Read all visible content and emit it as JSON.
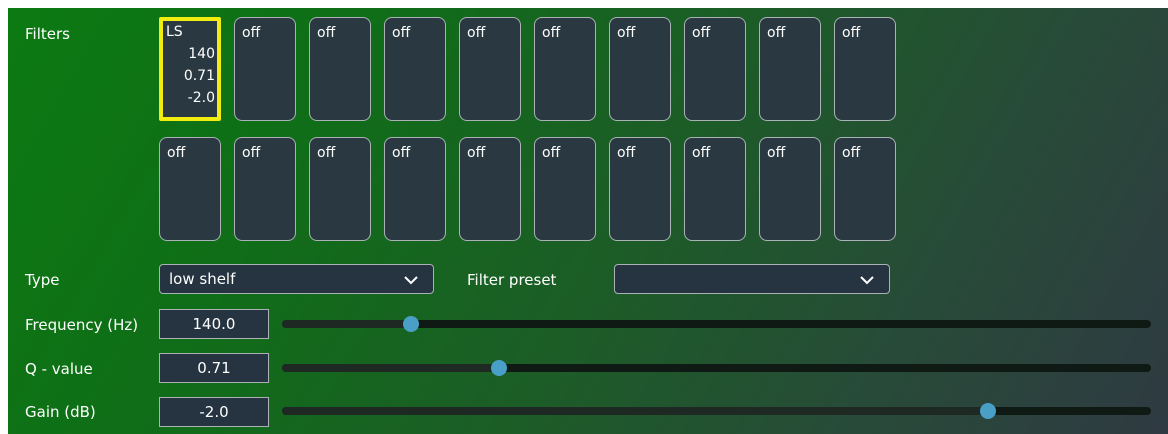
{
  "filters": {
    "label": "Filters",
    "row1": [
      {
        "lines": [
          "LS",
          "140",
          "0.71",
          "-2.0"
        ],
        "selected": true
      },
      {
        "lines": [
          "off"
        ]
      },
      {
        "lines": [
          "off"
        ]
      },
      {
        "lines": [
          "off"
        ]
      },
      {
        "lines": [
          "off"
        ]
      },
      {
        "lines": [
          "off"
        ]
      },
      {
        "lines": [
          "off"
        ]
      },
      {
        "lines": [
          "off"
        ]
      },
      {
        "lines": [
          "off"
        ]
      },
      {
        "lines": [
          "off"
        ]
      }
    ],
    "row2": [
      {
        "lines": [
          "off"
        ]
      },
      {
        "lines": [
          "off"
        ]
      },
      {
        "lines": [
          "off"
        ]
      },
      {
        "lines": [
          "off"
        ]
      },
      {
        "lines": [
          "off"
        ]
      },
      {
        "lines": [
          "off"
        ]
      },
      {
        "lines": [
          "off"
        ]
      },
      {
        "lines": [
          "off"
        ]
      },
      {
        "lines": [
          "off"
        ]
      },
      {
        "lines": [
          "off"
        ]
      }
    ]
  },
  "type": {
    "label": "Type",
    "value": "low shelf",
    "icon": "chevron-down-icon"
  },
  "preset": {
    "label": "Filter preset",
    "value": "",
    "icon": "chevron-down-icon"
  },
  "frequency": {
    "label": "Frequency (Hz)",
    "value": "140.0",
    "slider_fraction": 0.148
  },
  "q": {
    "label": "Q - value",
    "value": "0.71",
    "slider_fraction": 0.25
  },
  "gain": {
    "label": "Gain (dB)",
    "value": "-2.0",
    "slider_fraction": 0.812
  },
  "colors": {
    "selection": "#f3ec11",
    "thumb": "#4a9fc6",
    "panel_start": "#0c7a12",
    "panel_end": "#2f3a42"
  }
}
